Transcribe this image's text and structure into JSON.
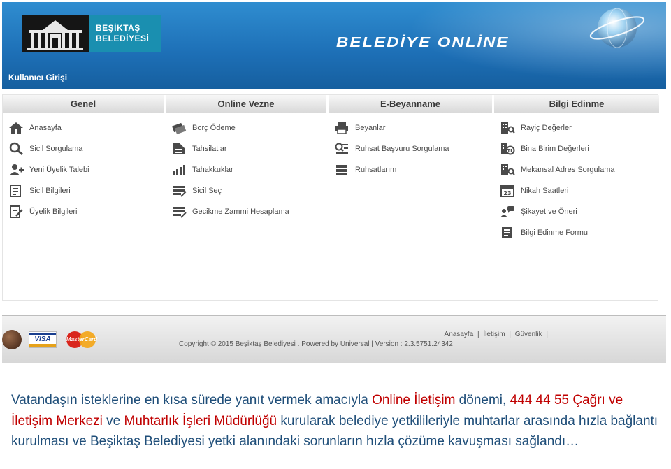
{
  "header": {
    "municipality_name_line1": "BEŞİKTAŞ",
    "municipality_name_line2": "BELEDİYESİ",
    "brand_title": "BELEDİYE ONLİNE",
    "login_link": "Kullanıcı Girişi"
  },
  "menu": {
    "columns": [
      {
        "title": "Genel",
        "items": [
          {
            "label": "Anasayfa",
            "icon": "home-icon"
          },
          {
            "label": "Sicil Sorgulama",
            "icon": "magnifier-icon"
          },
          {
            "label": "Yeni Üyelik Talebi",
            "icon": "add-user-icon"
          },
          {
            "label": "Sicil Bilgileri",
            "icon": "document-list-icon"
          },
          {
            "label": "Üyelik Bilgileri",
            "icon": "document-edit-icon"
          }
        ]
      },
      {
        "title": "Online Vezne",
        "items": [
          {
            "label": "Borç Ödeme",
            "icon": "cards-icon"
          },
          {
            "label": "Tahsilatlar",
            "icon": "receipt-icon"
          },
          {
            "label": "Tahakkuklar",
            "icon": "bar-chart-icon"
          },
          {
            "label": "Sicil Seç",
            "icon": "list-select-icon"
          },
          {
            "label": "Gecikme Zammi Hesaplama",
            "icon": "calculator-icon"
          }
        ]
      },
      {
        "title": "E-Beyanname",
        "items": [
          {
            "label": "Beyanlar",
            "icon": "printer-icon"
          },
          {
            "label": "Ruhsat Başvuru Sorgulama",
            "icon": "search-list-icon"
          },
          {
            "label": "Ruhsatlarım",
            "icon": "stack-list-icon"
          }
        ]
      },
      {
        "title": "Bilgi Edinme",
        "items": [
          {
            "label": "Rayiç Değerler",
            "icon": "building-search-icon"
          },
          {
            "label": "Bina Birim Değerleri",
            "icon": "building-currency-icon"
          },
          {
            "label": "Mekansal Adres Sorgulama",
            "icon": "building-search-icon"
          },
          {
            "label": "Nikah Saatleri",
            "icon": "calendar-icon"
          },
          {
            "label": "Şikayet ve Öneri",
            "icon": "speech-user-icon"
          },
          {
            "label": "Bilgi Edinme Formu",
            "icon": "form-icon"
          }
        ]
      }
    ]
  },
  "footer": {
    "links": [
      "Anasayfa",
      "İletişim",
      "Güvenlik"
    ],
    "copyright": "Copyright © 2015 Beşiktaş Belediyesi . Powered by Universal",
    "version": "Version : 2.3.5751.24342",
    "card_visa": "VISA",
    "card_mastercard": "MasterCard"
  },
  "caption": {
    "part1": "Vatandaşın isteklerine en kısa sürede yanıt vermek amacıyla ",
    "part2": "Online İletişim",
    "part3": " dönemi, ",
    "part4": "444 44 55 Çağrı ve İletişim Merkezi",
    "part5": " ve ",
    "part6": "Muhtarlık İşleri Müdürlüğü",
    "part7": " kurularak belediye yetkilileriyle muhtarlar arasında hızla bağlantı kurulması ve Beşiktaş Belediyesi yetki alanındaki sorunların hızla çözüme kavuşması sağlandı…"
  },
  "colors": {
    "header_blue": "#1d6fb6",
    "caption_blue": "#1f4e79",
    "caption_red": "#c00000"
  }
}
